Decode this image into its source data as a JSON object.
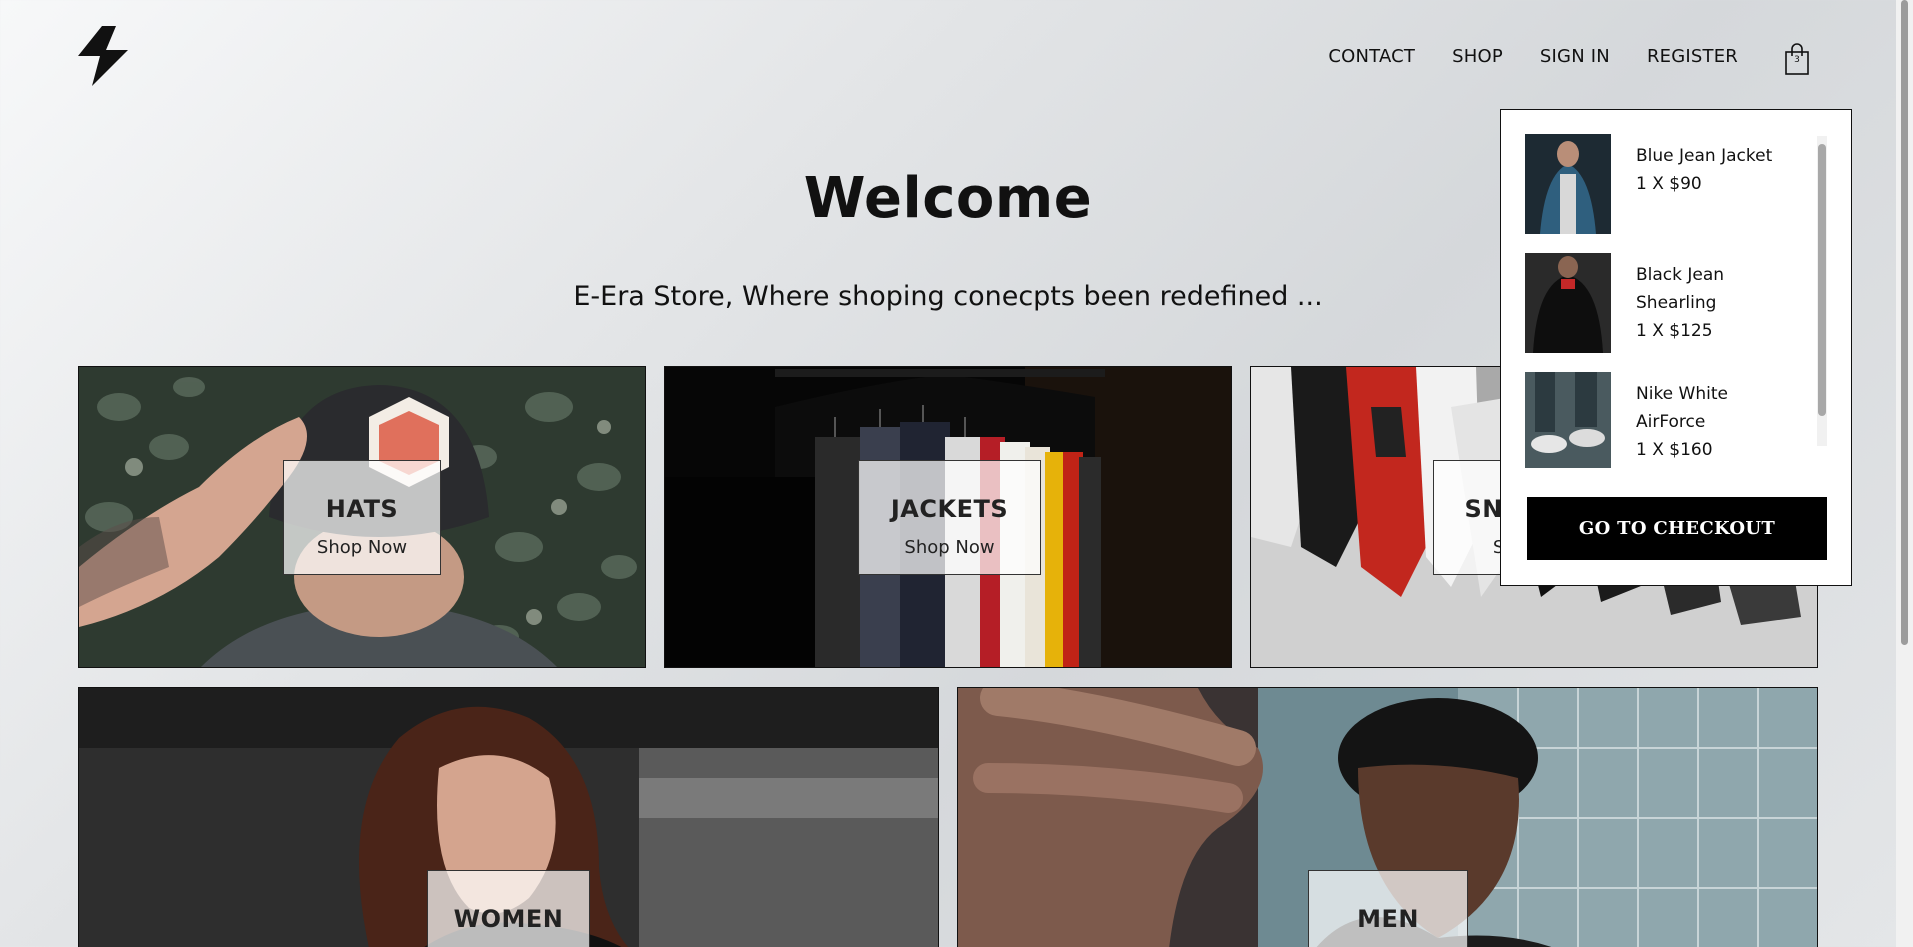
{
  "nav": {
    "links": [
      "CONTACT",
      "SHOP",
      "SIGN IN",
      "REGISTER"
    ],
    "cart_count": "3"
  },
  "hero": {
    "title": "Welcome",
    "tagline": "E-Era Store, Where shoping conecpts been redefined ..."
  },
  "categories": [
    {
      "title": "HATS",
      "subtitle": "Shop Now"
    },
    {
      "title": "JACKETS",
      "subtitle": "Shop Now"
    },
    {
      "title": "SNEAKERS",
      "subtitle": "Shop Now"
    },
    {
      "title": "WOMEN",
      "subtitle": ""
    },
    {
      "title": "MEN",
      "subtitle": ""
    }
  ],
  "cart": {
    "items": [
      {
        "name": "Blue Jean Jacket",
        "qty_price": "1 X $90"
      },
      {
        "name": "Black Jean Shearling",
        "qty_price": "1 X $125"
      },
      {
        "name": "Nike White AirForce",
        "qty_price": "1 X $160"
      }
    ],
    "checkout_label": "GO TO CHECKOUT"
  },
  "colors": {
    "accent": "#000000",
    "background": "#e4e6e8"
  }
}
